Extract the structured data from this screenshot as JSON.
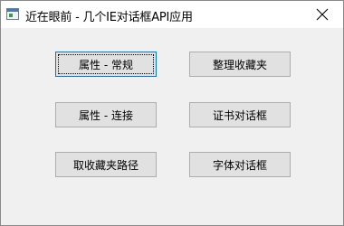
{
  "window": {
    "title": "近在眼前 - 几个IE对话框API应用"
  },
  "titlebar": {
    "app_icon": "window-app-icon",
    "close_icon": "close-icon"
  },
  "buttons": {
    "props_general": "属性 - 常规",
    "organize_favorites": "整理收藏夹",
    "props_connections": "属性 - 连接",
    "cert_dialog": "证书对话框",
    "favorites_path": "取收藏夹路径",
    "font_dialog": "字体对话框"
  },
  "colors": {
    "focus_border": "#0078d7",
    "button_face": "#e1e1e1",
    "dialog_background": "#f0f0f0"
  }
}
